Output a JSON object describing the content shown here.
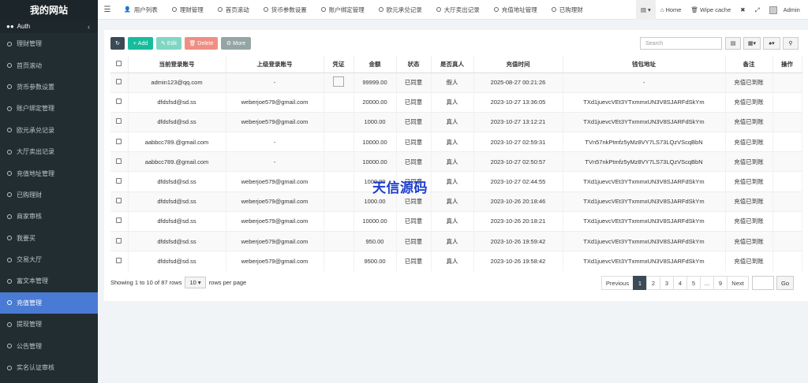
{
  "brand": "我的网站",
  "sidebar": {
    "auth_label": "Auth",
    "items": [
      {
        "label": "理财管理"
      },
      {
        "label": "首页滚动"
      },
      {
        "label": "货币参数设置"
      },
      {
        "label": "账户绑定管理"
      },
      {
        "label": "欧元承兑记录"
      },
      {
        "label": "大厅卖出记录"
      },
      {
        "label": "充值地址管理"
      },
      {
        "label": "已购理财"
      },
      {
        "label": "商家审核"
      },
      {
        "label": "我要买"
      },
      {
        "label": "交易大厅"
      },
      {
        "label": "富文本管理"
      },
      {
        "label": "充值管理"
      },
      {
        "label": "提现管理"
      },
      {
        "label": "公告管理"
      },
      {
        "label": "实名认证审核"
      }
    ],
    "active_index": 12
  },
  "topnav": {
    "tabs": [
      "用户列表",
      "理财管理",
      "首页滚动",
      "货币参数设置",
      "账户绑定管理",
      "欧元承兑记录",
      "大厅卖出记录",
      "充值地址管理",
      "已购理财"
    ],
    "home": "Home",
    "wipe": "Wipe cache",
    "user": "Admin"
  },
  "toolbar": {
    "add": "Add",
    "edit": "Edit",
    "delete": "Delete",
    "more": "More",
    "search_placeholder": "Search"
  },
  "table": {
    "headers": [
      "当前登录账号",
      "上级登录账号",
      "凭证",
      "金额",
      "状态",
      "是否真人",
      "充值时间",
      "钱包地址",
      "备注",
      "操作"
    ],
    "rows": [
      {
        "account": "admin123@qq.com",
        "parent": "-",
        "img": true,
        "amount": "99999.00",
        "status": "已同意",
        "real": "假人",
        "time": "2025-08-27 00:21:26",
        "wallet": "-",
        "note": "充值已到账"
      },
      {
        "account": "dfdsfsd@sd.ss",
        "parent": "weberjoe579@gmail.com",
        "img": false,
        "amount": "20000.00",
        "status": "已同意",
        "real": "真人",
        "time": "2023-10-27 13:36:05",
        "wallet": "TXd1juevcVEt3YTxmmxUN3V8SJARFdSkYm",
        "note": "充值已到账"
      },
      {
        "account": "dfdsfsd@sd.ss",
        "parent": "weberjoe579@gmail.com",
        "img": false,
        "amount": "1000.00",
        "status": "已同意",
        "real": "真人",
        "time": "2023-10-27 13:12:21",
        "wallet": "TXd1juevcVEt3YTxmmxUN3V8SJARFdSkYm",
        "note": "充值已到账"
      },
      {
        "account": "aabbcc789.@gmail.com",
        "parent": "-",
        "img": false,
        "amount": "10000.00",
        "status": "已同意",
        "real": "真人",
        "time": "2023-10-27 02:59:31",
        "wallet": "TVn57nkPtmfz5yMz8VY7LS73LQzVScqBbN",
        "note": "充值已到账"
      },
      {
        "account": "aabbcc789.@gmail.com",
        "parent": "-",
        "img": false,
        "amount": "10000.00",
        "status": "已同意",
        "real": "真人",
        "time": "2023-10-27 02:50:57",
        "wallet": "TVn57nkPtmfz5yMz8VY7LS73LQzVScqBbN",
        "note": "充值已到账"
      },
      {
        "account": "dfdsfsd@sd.ss",
        "parent": "weberjoe579@gmail.com",
        "img": false,
        "amount": "1000.00",
        "status": "已同意",
        "real": "真人",
        "time": "2023-10-27 02:44:55",
        "wallet": "TXd1juevcVEt3YTxmmxUN3V8SJARFdSkYm",
        "note": "充值已到账"
      },
      {
        "account": "dfdsfsd@sd.ss",
        "parent": "weberjoe579@gmail.com",
        "img": false,
        "amount": "1000.00",
        "status": "已同意",
        "real": "真人",
        "time": "2023-10-26 20:18:46",
        "wallet": "TXd1juevcVEt3YTxmmxUN3V8SJARFdSkYm",
        "note": "充值已到账"
      },
      {
        "account": "dfdsfsd@sd.ss",
        "parent": "weberjoe579@gmail.com",
        "img": false,
        "amount": "10000.00",
        "status": "已同意",
        "real": "真人",
        "time": "2023-10-26 20:18:21",
        "wallet": "TXd1juevcVEt3YTxmmxUN3V8SJARFdSkYm",
        "note": "充值已到账"
      },
      {
        "account": "dfdsfsd@sd.ss",
        "parent": "weberjoe579@gmail.com",
        "img": false,
        "amount": "950.00",
        "status": "已同意",
        "real": "真人",
        "time": "2023-10-26 19:59:42",
        "wallet": "TXd1juevcVEt3YTxmmxUN3V8SJARFdSkYm",
        "note": "充值已到账"
      },
      {
        "account": "dfdsfsd@sd.ss",
        "parent": "weberjoe579@gmail.com",
        "img": false,
        "amount": "9500.00",
        "status": "已同意",
        "real": "真人",
        "time": "2023-10-26 19:58:42",
        "wallet": "TXd1juevcVEt3YTxmmxUN3V8SJARFdSkYm",
        "note": "充值已到账"
      }
    ]
  },
  "footer": {
    "showing": "Showing 1 to 10 of 87 rows",
    "page_size": "10",
    "rows_per_page": "rows per page",
    "pages": [
      "Previous",
      "1",
      "2",
      "3",
      "4",
      "5",
      "...",
      "9",
      "Next"
    ],
    "active_page": "1",
    "go": "Go"
  },
  "watermark": "天信源码"
}
